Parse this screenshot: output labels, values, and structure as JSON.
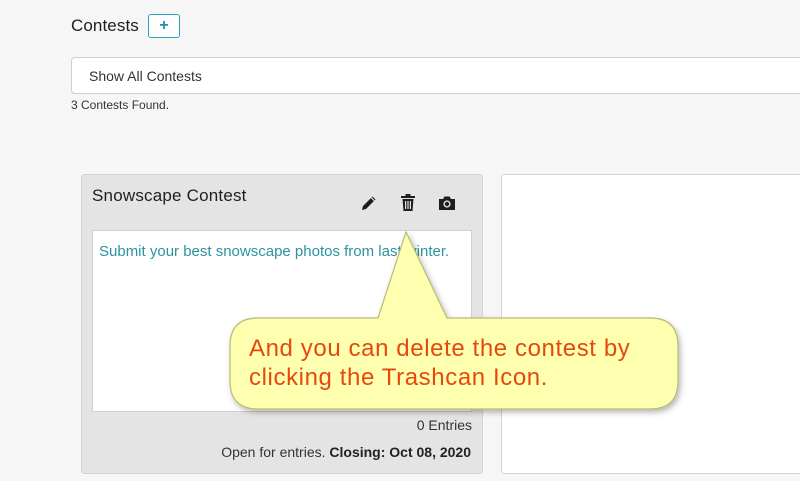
{
  "header": {
    "title": "Contests",
    "add_label": "+"
  },
  "filter": {
    "selected": "Show All Contests"
  },
  "results": {
    "count_text": "3 Contests Found."
  },
  "card": {
    "title": "Snowscape Contest",
    "description": "Submit your best snowscape photos from last winter.",
    "entries": "0 Entries",
    "status_prefix": "Open for entries.",
    "closing": "Closing: Oct 08, 2020",
    "icons": [
      "pencil-icon",
      "trash-icon",
      "camera-icon"
    ]
  },
  "callout": {
    "line1": "And you can delete the contest by",
    "line2": "clicking the Trashcan Icon."
  },
  "colors": {
    "accent": "#2aa0c0",
    "description_text": "#2b93a0",
    "callout_fill": "#ffffb0",
    "callout_text": "#e8480e"
  }
}
